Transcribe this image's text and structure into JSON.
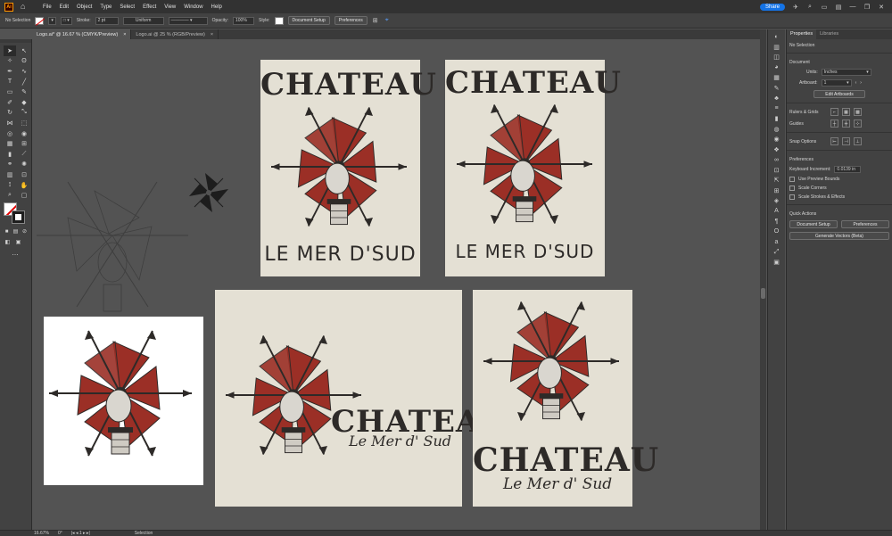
{
  "app": {
    "logo": "Ai",
    "share_label": "Share"
  },
  "menu": [
    "File",
    "Edit",
    "Object",
    "Type",
    "Select",
    "Effect",
    "View",
    "Window",
    "Help"
  ],
  "control_bar": {
    "selection": "No Selection",
    "stroke_label": "Stroke:",
    "stroke_value": "2 pt",
    "uniform": "Uniform",
    "opacity_label": "Opacity:",
    "opacity_value": "100%",
    "style_label": "Style:",
    "document_setup": "Document Setup",
    "preferences": "Preferences"
  },
  "tabs": [
    {
      "label": "Logo.ai* @ 16.67 % (CMYK/Preview)",
      "close": "×"
    },
    {
      "label": "Logo.ai @ 25 % (RGB/Preview)",
      "close": "×"
    }
  ],
  "artboards": {
    "top_left": {
      "title": "CHATEAU",
      "subtitle": "LE MER D'SUD"
    },
    "top_right": {
      "title": "CHATEAU",
      "subtitle": "LE MER D'SUD"
    },
    "bottom_mid": {
      "title": "CHATEAU",
      "subtitle": "Le Mer d' Sud"
    },
    "bottom_right": {
      "title": "CHATEAU",
      "subtitle": "Le Mer d' Sud"
    }
  },
  "properties": {
    "tab_properties": "Properties",
    "tab_libraries": "Libraries",
    "no_selection": "No Selection",
    "document_title": "Document",
    "units_label": "Units:",
    "units_value": "Inches",
    "artboard_label": "Artboard:",
    "artboard_value": "1",
    "edit_artboards": "Edit Artboards",
    "rulers_grids": "Rulers & Grids",
    "guides": "Guides",
    "snap_options": "Snap Options",
    "preferences_title": "Preferences",
    "keyboard_increment_label": "Keyboard Increment:",
    "keyboard_increment_value": "0.0139 in",
    "use_preview_bounds": "Use Preview Bounds",
    "scale_corners": "Scale Corners",
    "scale_strokes": "Scale Strokes & Effects",
    "quick_actions": "Quick Actions",
    "document_setup_btn": "Document Setup",
    "preferences_btn": "Preferences",
    "generate_vectors": "Generate Vectors (Beta)"
  },
  "status": {
    "zoom": "16.67%",
    "rotation": "0°",
    "page": "1",
    "tool": "Selection"
  },
  "colors": {
    "accent": "#1473e6",
    "artboard_bg": "#e4e0d4",
    "logo_red": "#9b2f26",
    "ink": "#2d2a28"
  }
}
